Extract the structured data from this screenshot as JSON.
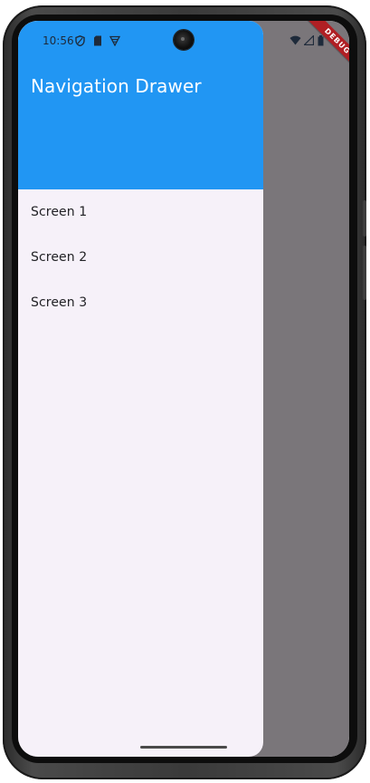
{
  "status_bar": {
    "time": "10:56",
    "icons_left": [
      "shield-icon",
      "sd-card-icon",
      "vpn-icon"
    ],
    "icons_right": [
      "wifi-icon",
      "signal-icon",
      "battery-icon"
    ]
  },
  "drawer": {
    "title": "Navigation Drawer",
    "header_color": "#2196f3",
    "items": [
      {
        "label": "Screen 1"
      },
      {
        "label": "Screen 2"
      },
      {
        "label": "Screen 3"
      }
    ]
  },
  "debug_banner": "DEBUG",
  "colors": {
    "drawer_background": "#f6f1f9",
    "scrim": "#7a767a",
    "debug_banner": "#b01f24"
  }
}
